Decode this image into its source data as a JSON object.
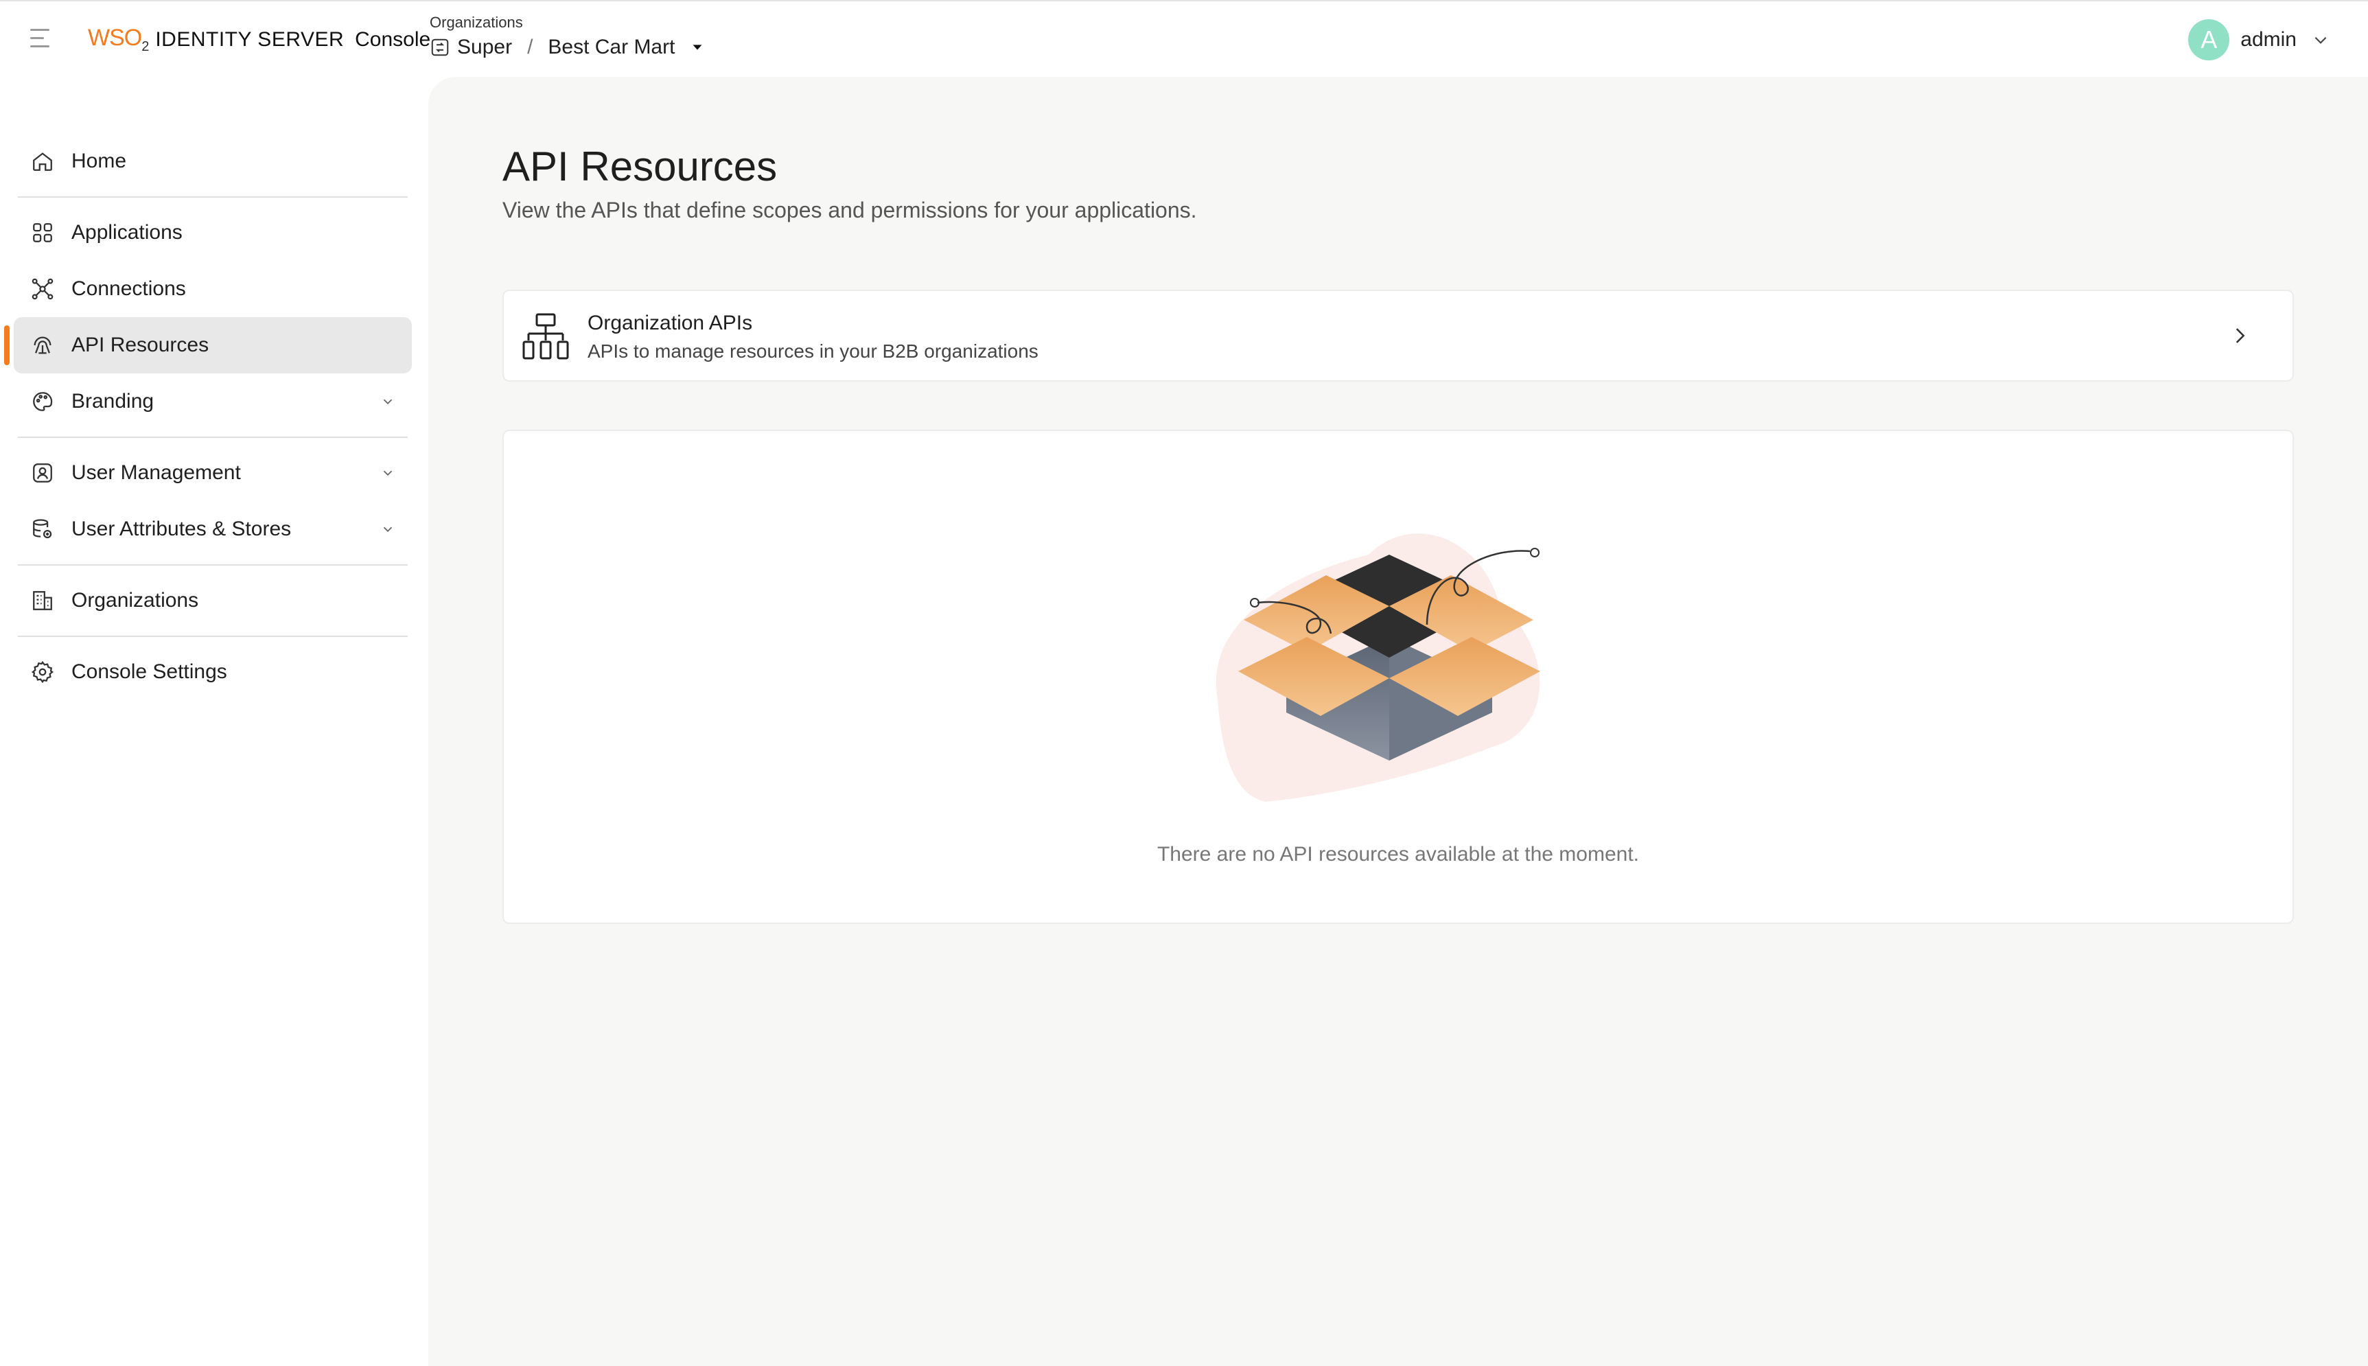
{
  "header": {
    "logo_brand": "WSO",
    "logo_brand_sub": "2",
    "logo_product": "IDENTITY SERVER",
    "logo_console": "Console",
    "org_switcher": {
      "label": "Organizations",
      "root": "Super",
      "separator": "/",
      "current": "Best Car Mart"
    },
    "user": {
      "avatar_letter": "A",
      "name": "admin"
    }
  },
  "sidebar": {
    "items": [
      {
        "label": "Home",
        "icon": "home-icon"
      },
      {
        "label": "Applications",
        "icon": "grid-icon"
      },
      {
        "label": "Connections",
        "icon": "connections-icon"
      },
      {
        "label": "API Resources",
        "icon": "api-icon",
        "active": true
      },
      {
        "label": "Branding",
        "icon": "palette-icon",
        "expandable": true
      },
      {
        "label": "User Management",
        "icon": "user-icon",
        "expandable": true
      },
      {
        "label": "User Attributes & Stores",
        "icon": "database-icon",
        "expandable": true
      },
      {
        "label": "Organizations",
        "icon": "building-icon"
      },
      {
        "label": "Console Settings",
        "icon": "gear-icon"
      }
    ]
  },
  "main": {
    "title": "API Resources",
    "description": "View the APIs that define scopes and permissions for your applications.",
    "org_apis_card": {
      "title": "Organization APIs",
      "subtitle": "APIs to manage resources in your B2B organizations"
    },
    "empty_state": {
      "message": "There are no API resources available at the moment."
    }
  },
  "colors": {
    "accent": "#f47b20",
    "avatar": "#8fe0c4",
    "active_bg": "#e8e8e8",
    "content_bg": "#f7f7f6"
  }
}
